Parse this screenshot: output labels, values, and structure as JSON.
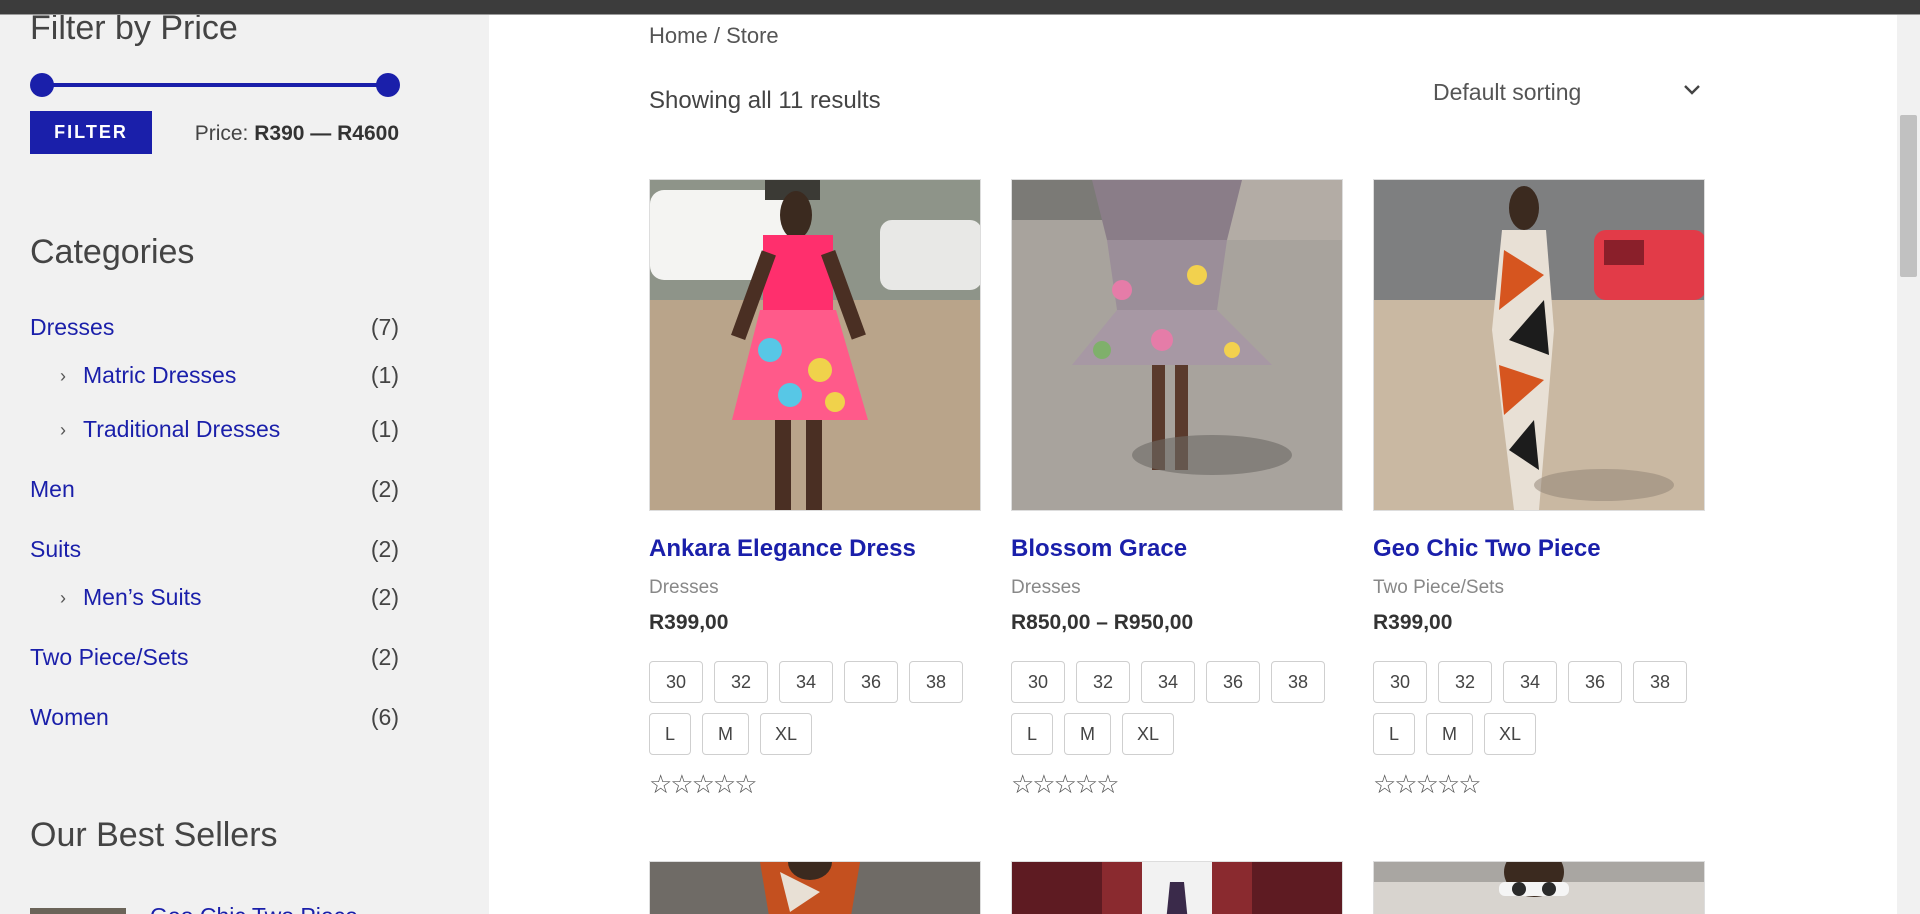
{
  "sidebar": {
    "filter_heading": "Filter by Price",
    "filter_button": "FILTER",
    "price_prefix": "Price:",
    "price_min": "R390",
    "price_sep": "—",
    "price_max": "R4600",
    "price_slider": {
      "min_pct": 0,
      "max_pct": 100
    },
    "categories_heading": "Categories",
    "categories": [
      {
        "label": "Dresses",
        "count": "(7)",
        "sub": false
      },
      {
        "label": "Matric Dresses",
        "count": "(1)",
        "sub": true
      },
      {
        "label": "Traditional Dresses",
        "count": "(1)",
        "sub": true
      },
      {
        "label": "Men",
        "count": "(2)",
        "sub": false
      },
      {
        "label": "Suits",
        "count": "(2)",
        "sub": false
      },
      {
        "label": "Men’s Suits",
        "count": "(2)",
        "sub": true
      },
      {
        "label": "Two Piece/Sets",
        "count": "(2)",
        "sub": false
      },
      {
        "label": "Women",
        "count": "(6)",
        "sub": false
      }
    ],
    "best_sellers_heading": "Our Best Sellers",
    "best_seller_first": "Geo Chic Two Piece"
  },
  "breadcrumb": {
    "home": "Home",
    "sep": "/",
    "current": "Store"
  },
  "results_text": "Showing all 11 results",
  "sorting": {
    "selected": "Default sorting"
  },
  "products": [
    {
      "name": "Ankara Elegance Dress",
      "category": "Dresses",
      "price": "R399,00",
      "sizes_num": [
        "30",
        "32",
        "34",
        "36",
        "38"
      ],
      "sizes_alpha": [
        "L",
        "M",
        "XL"
      ],
      "stars": "☆☆☆☆☆"
    },
    {
      "name": "Blossom Grace",
      "category": "Dresses",
      "price": "R850,00 – R950,00",
      "sizes_num": [
        "30",
        "32",
        "34",
        "36",
        "38"
      ],
      "sizes_alpha": [
        "L",
        "M",
        "XL"
      ],
      "stars": "☆☆☆☆☆"
    },
    {
      "name": "Geo Chic Two Piece",
      "category": "Two Piece/Sets",
      "price": "R399,00",
      "sizes_num": [
        "30",
        "32",
        "34",
        "36",
        "38"
      ],
      "sizes_alpha": [
        "L",
        "M",
        "XL"
      ],
      "stars": "☆☆☆☆☆"
    }
  ],
  "colors": {
    "accent": "#1a1faa",
    "sidebar_bg": "#f1f1f1"
  }
}
